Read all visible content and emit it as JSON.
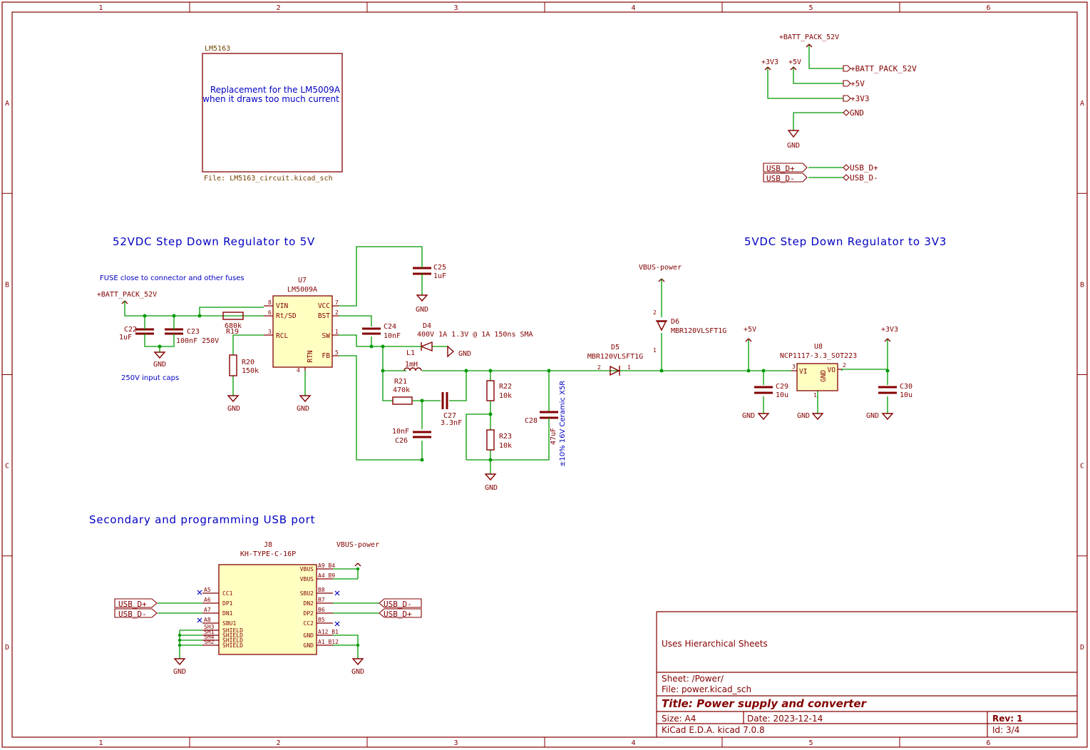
{
  "frame": {
    "columns": [
      "1",
      "2",
      "3",
      "4",
      "5",
      "6"
    ],
    "rows": [
      "A",
      "B",
      "C",
      "D"
    ]
  },
  "title_block": {
    "comment": "Uses Hierarchical Sheets",
    "sheet": "Sheet: /Power/",
    "file": "File: power.kicad_sch",
    "title": "Title: Power supply and converter",
    "size": "Size: A4",
    "date": "Date: 2023-12-14",
    "rev": "Rev: 1",
    "tool": "KiCad E.D.A.  kicad 7.0.8",
    "id": "Id: 3/4"
  },
  "hier_sheet": {
    "name": "LM5163",
    "file": "File: LM5163_circuit.kicad_sch",
    "note_line1": "Replacement for the LM5009A",
    "note_line2": "when it draws too much current"
  },
  "section_titles": {
    "reg_52v": "52VDC Step Down Regulator to 5V",
    "reg_3v3": "5VDC Step Down Regulator to 3V3",
    "usb_port": "Secondary and programming USB port"
  },
  "notes": {
    "fuse": "FUSE close to connector and other fuses",
    "input_caps": "250V input caps",
    "c28_rating": "±10% 16V Ceramic X5R"
  },
  "power_ports": {
    "batt": "+BATT_PACK_52V",
    "v5": "+5V",
    "v3v3": "+3V3",
    "gnd": "GND",
    "vbus": "VBUS-power"
  },
  "global_labels": {
    "batt": "+BATT_PACK_52V",
    "v5": "+5V",
    "v3v3": "+3V3",
    "gnd": "GND",
    "usb_dp": "USB_D+",
    "usb_dm": "USB_D-"
  },
  "components": {
    "u7_ref": "U7",
    "u7_val": "LM5009A",
    "u7_pins": [
      "VIN",
      "Rt/SD",
      "RCL",
      "VCC",
      "BST",
      "SW",
      "FB",
      "RTN"
    ],
    "u7_nums": [
      "8",
      "6",
      "3",
      "7",
      "2",
      "1",
      "5",
      "4"
    ],
    "c22_ref": "C22",
    "c22_val": "1uF",
    "c23_ref": "C23",
    "c23_val": "100nF 250V",
    "r19_ref": "R19",
    "r19_val": "680k",
    "r20_ref": "R20",
    "r20_val": "150k",
    "c24_ref": "C24",
    "c24_val": "10nF",
    "c25_ref": "C25",
    "c25_val": "1uF",
    "d4_ref": "D4",
    "d4_val": "400V 1A 1.3V @ 1A 150ns SMA",
    "l1_ref": "L1",
    "l1_val": "1mH",
    "r21_ref": "R21",
    "r21_val": "470k",
    "c27_ref": "C27",
    "c27_val": "3.3nF",
    "c26_ref": "C26",
    "c26_val": "10nF",
    "r22_ref": "R22",
    "r22_val": "10k",
    "r23_ref": "R23",
    "r23_val": "10k",
    "c28_ref": "C28",
    "c28_val": "47uF",
    "d5_ref": "D5",
    "d5_val": "MBR120VLSFT1G",
    "d6_ref": "D6",
    "d6_val": "MBR120VLSFT1G",
    "u8_ref": "U8",
    "u8_val": "NCP1117-3.3_SOT223",
    "u8_pins": [
      "VI",
      "VO",
      "GND"
    ],
    "u8_nums": [
      "3",
      "2",
      "1"
    ],
    "c29_ref": "C29",
    "c29_val": "10u",
    "c30_ref": "C30",
    "c30_val": "10u",
    "j8_ref": "J8",
    "j8_val": "KH-TYPE-C-16P",
    "j8_left_pins": [
      "CC1",
      "DP1",
      "DN1",
      "SBU1",
      "SHIELD",
      "SHIELD",
      "SHIELD",
      "SHIELD"
    ],
    "j8_left_nums": [
      "A5",
      "A6",
      "A7",
      "A8",
      "SH3",
      "SH1",
      "SH4",
      "SH2"
    ],
    "j8_right_pins": [
      "VBUS",
      "VBUS",
      "SBU2",
      "DN2",
      "DP2",
      "CC2",
      "GND",
      "GND"
    ],
    "j8_right_nums": [
      "A9_B4",
      "A4_B9",
      "B8",
      "B7",
      "B6",
      "B5",
      "A12_B1",
      "A1_B12"
    ]
  },
  "diode_pin_nums": {
    "d5_a": "2",
    "d5_k": "1",
    "d6_k": "1",
    "d6_a": "2"
  }
}
